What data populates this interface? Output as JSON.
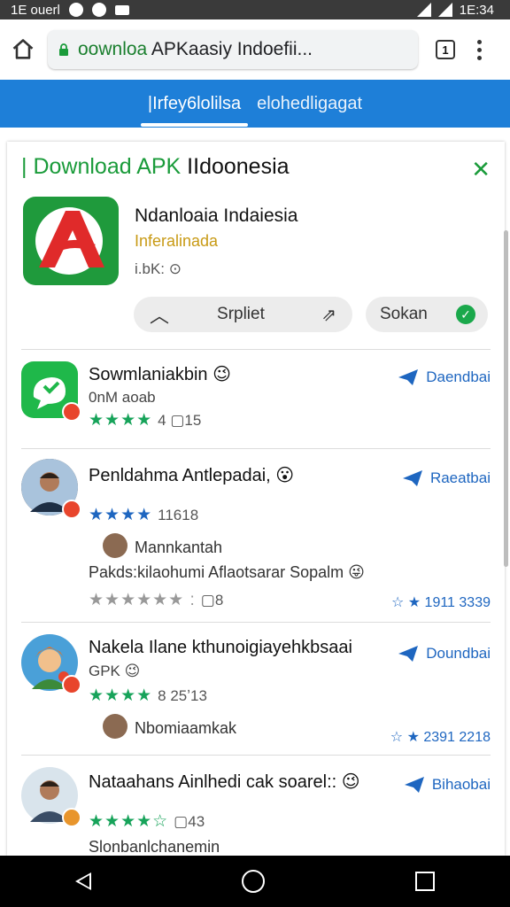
{
  "status": {
    "left_text": "1E ouerl",
    "time": "1E:34"
  },
  "browser": {
    "url_green": "oownloa",
    "url_rest": " APKaasiy Indoefii...",
    "tab_count": "1"
  },
  "header_tabs": [
    "|Irfey6lolilsa",
    "elohedligagat"
  ],
  "card": {
    "title_green": "| Download APK ",
    "title_dark": "IIdoonesia",
    "app_name": "Ndanloaia Indaiesia",
    "app_sub": "Inferalinada",
    "app_meta": "i.bK: ⊙",
    "pill_left": "Srpliet",
    "pill_right": "Sokan"
  },
  "items": [
    {
      "title": "Sowmlaniakbin 😉",
      "sub": "0nM aoab",
      "stars": "★★★★",
      "rating_count": "4 ▢15",
      "action": "Daendbai"
    },
    {
      "title": "Penldahma Antlepadai, 😮",
      "stars": "★★★★",
      "rating_count": "11618",
      "action": "Raeatbai",
      "reply_name": "Mannkantah",
      "reply_text": "Pakds:kilaohumi Aflaotsarar Sopalm 😜",
      "reply_stars": "★★★★★★ :",
      "reply_count": "▢8",
      "right_rating": "1911 3339"
    },
    {
      "title": "Nakela Ilane kthunoigiayehkbsaai",
      "sub": "GPK 😉",
      "stars": "★★★★",
      "rating_count": "8 25ʼ13",
      "action": "Doundbai",
      "reply_name": "Nbomiaamkak",
      "right_rating": "2391 2218"
    },
    {
      "title": "Nataahans Ainlhedi cak soarel:: 😉",
      "stars": "★★★★☆",
      "rating_count": "▢43",
      "action": "Bihaobai",
      "reply_name": "Slonbanlchanemin"
    }
  ],
  "colors": {
    "accent_blue": "#1e7fd8",
    "green": "#1a9b3a"
  }
}
